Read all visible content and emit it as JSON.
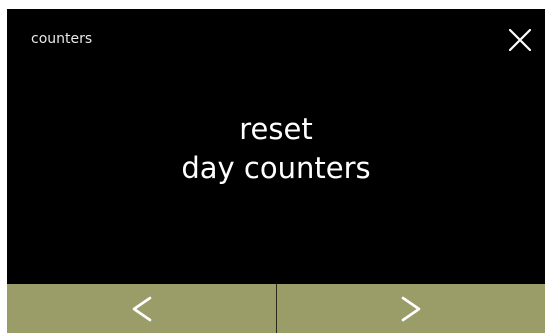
{
  "header": {
    "title": "counters",
    "close_icon": "close-icon"
  },
  "main": {
    "line1": "reset",
    "line2": "day counters"
  },
  "nav": {
    "prev_icon": "chevron-left-icon",
    "next_icon": "chevron-right-icon"
  },
  "colors": {
    "background": "#000000",
    "text": "#ffffff",
    "nav_bar": "#9b9d69",
    "nav_glyph": "#ffffff"
  }
}
